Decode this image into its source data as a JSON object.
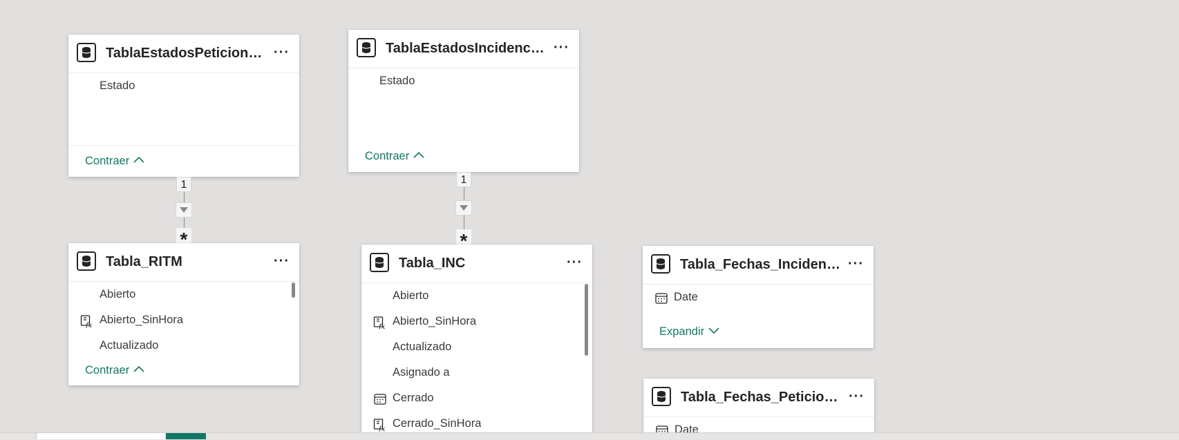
{
  "tables": {
    "estados_peticiones": {
      "title": "TablaEstadosPeticiones...",
      "fields": [
        "Estado"
      ],
      "footer": "Contraer"
    },
    "estados_incidencias": {
      "title": "TablaEstadosIncidencias...",
      "fields": [
        "Estado"
      ],
      "footer": "Contraer"
    },
    "ritm": {
      "title": "Tabla_RITM",
      "fields": [
        "Abierto",
        "Abierto_SinHora",
        "Actualizado"
      ],
      "footer": "Contraer"
    },
    "inc": {
      "title": "Tabla_INC",
      "fields": [
        "Abierto",
        "Abierto_SinHora",
        "Actualizado",
        "Asignado a",
        "Cerrado",
        "Cerrado_SinHora"
      ]
    },
    "fechas_incidencias": {
      "title": "Tabla_Fechas_Incidencias",
      "fields": [
        "Date"
      ],
      "footer": "Expandir"
    },
    "fechas_peticiones": {
      "title": "Tabla_Fechas_Peticiones",
      "fields": [
        "Date"
      ]
    }
  },
  "relationships": {
    "one_label": "1",
    "many_label": "*"
  },
  "more_label": "···",
  "accent_color": "#117865"
}
